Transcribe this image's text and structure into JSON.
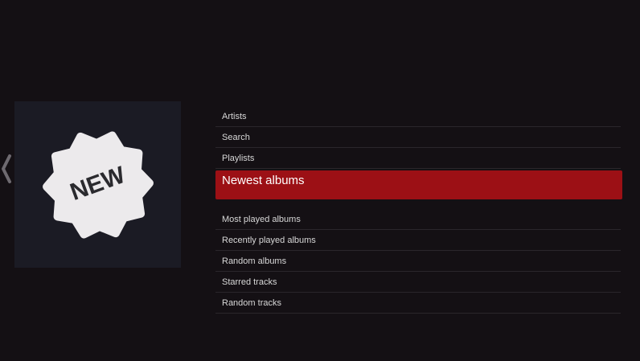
{
  "colors": {
    "background": "#141014",
    "artwork_background": "#1b1b24",
    "selected_accent": "#9c1015",
    "badge_fill": "#eceaec",
    "text": "#d8d8d8"
  },
  "navigation": {
    "back_icon": "chevron-left-icon"
  },
  "artwork": {
    "badge_icon": "new-badge-icon",
    "badge_text": "NEW"
  },
  "menu": {
    "items": [
      {
        "label": "Artists",
        "selected": false
      },
      {
        "label": "Search",
        "selected": false
      },
      {
        "label": "Playlists",
        "selected": false
      },
      {
        "label": "Newest albums",
        "selected": true
      },
      {
        "label": "Most played albums",
        "selected": false
      },
      {
        "label": "Recently played albums",
        "selected": false
      },
      {
        "label": "Random albums",
        "selected": false
      },
      {
        "label": "Starred tracks",
        "selected": false
      },
      {
        "label": "Random tracks",
        "selected": false
      }
    ]
  }
}
